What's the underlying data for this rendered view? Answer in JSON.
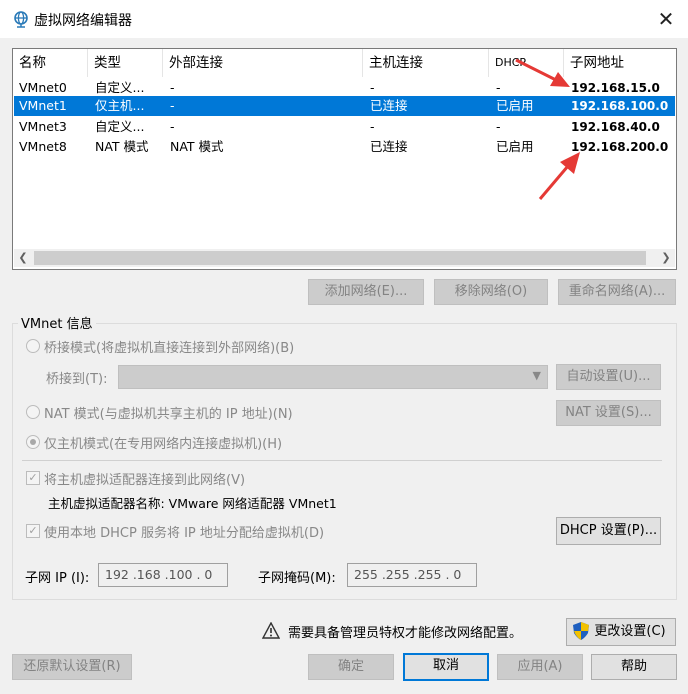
{
  "window": {
    "title": "虚拟网络编辑器",
    "close": "✕"
  },
  "table": {
    "headers": [
      "名称",
      "类型",
      "外部连接",
      "主机连接",
      "DHCP",
      "子网地址"
    ],
    "rows": [
      [
        "VMnet0",
        "自定义...",
        "-",
        "-",
        "-",
        "192.168.15.0"
      ],
      [
        "VMnet1",
        "仅主机...",
        "-",
        "已连接",
        "已启用",
        "192.168.100.0"
      ],
      [
        "VMnet3",
        "自定义...",
        "-",
        "-",
        "-",
        "192.168.40.0"
      ],
      [
        "VMnet8",
        "NAT 模式",
        "NAT 模式",
        "已连接",
        "已启用",
        "192.168.200.0"
      ]
    ],
    "selected_row": 1
  },
  "buttons": {
    "add_network": "添加网络(E)...",
    "remove_network": "移除网络(O)",
    "rename_network": "重命名网络(A)...",
    "auto_settings": "自动设置(U)...",
    "nat_settings": "NAT 设置(S)...",
    "dhcp_settings": "DHCP 设置(P)...",
    "change_settings": "更改设置(C)",
    "restore_defaults": "还原默认设置(R)",
    "ok": "确定",
    "cancel": "取消",
    "apply": "应用(A)",
    "help": "帮助"
  },
  "info": {
    "group_label": "VMnet 信息",
    "bridged_mode": "桥接模式(将虚拟机直接连接到外部网络)(B)",
    "bridged_to": "桥接到(T):",
    "nat_mode": "NAT 模式(与虚拟机共享主机的 IP 地址)(N)",
    "host_only_mode": "仅主机模式(在专用网络内连接虚拟机)(H)",
    "connect_adapter": "将主机虚拟适配器连接到此网络(V)",
    "adapter_name": "主机虚拟适配器名称: VMware 网络适配器 VMnet1",
    "use_dhcp": "使用本地 DHCP 服务将 IP 地址分配给虚拟机(D)",
    "subnet_ip_label": "子网 IP (I):",
    "subnet_ip": "192 .168 .100 .  0",
    "subnet_mask_label": "子网掩码(M):",
    "subnet_mask": "255 .255 .255 .  0"
  },
  "footer": {
    "admin_warning": "需要具备管理员特权才能修改网络配置。"
  },
  "colors": {
    "selection": "#0078d7",
    "arrow": "#e53935"
  }
}
